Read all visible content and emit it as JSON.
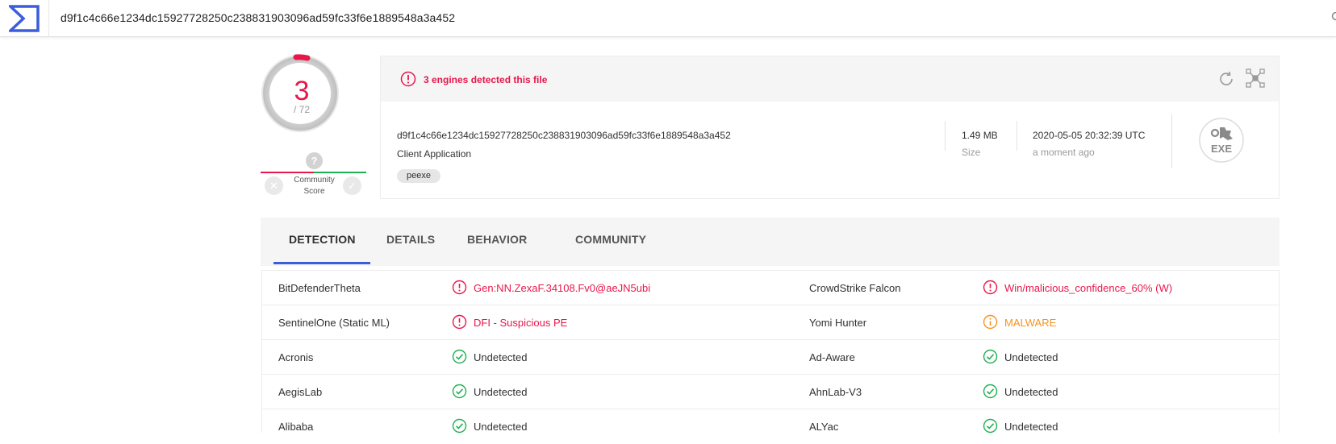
{
  "search": {
    "query": "d9f1c4c66e1234dc15927728250c238831903096ad59fc33f6e1889548a3a452"
  },
  "score": {
    "detected": "3",
    "total": "/ 72"
  },
  "community": {
    "label_line1": "Community",
    "label_line2": "Score",
    "unknown_glyph": "?"
  },
  "summary": {
    "alert": "3 engines detected this file",
    "hash": "d9f1c4c66e1234dc15927728250c238831903096ad59fc33f6e1889548a3a452",
    "file_type": "Client Application",
    "tag": "peexe",
    "size_value": "1.49 MB",
    "size_label": "Size",
    "date_value": "2020-05-05 20:32:39 UTC",
    "date_label": "a moment ago",
    "file_icon_label": "EXE"
  },
  "tabs": [
    {
      "label": "DETECTION",
      "active": true
    },
    {
      "label": "DETAILS",
      "active": false
    },
    {
      "label": "BEHAVIOR",
      "active": false
    },
    {
      "label": "COMMUNITY",
      "active": false
    }
  ],
  "detections": [
    {
      "left": {
        "engine": "BitDefenderTheta",
        "result": "Gen:NN.ZexaF.34108.Fv0@aeJN5ubi",
        "status": "malicious"
      },
      "right": {
        "engine": "CrowdStrike Falcon",
        "result": "Win/malicious_confidence_60% (W)",
        "status": "malicious"
      }
    },
    {
      "left": {
        "engine": "SentinelOne (Static ML)",
        "result": "DFI - Suspicious PE",
        "status": "malicious"
      },
      "right": {
        "engine": "Yomi Hunter",
        "result": "MALWARE",
        "status": "suspicious"
      }
    },
    {
      "left": {
        "engine": "Acronis",
        "result": "Undetected",
        "status": "clean"
      },
      "right": {
        "engine": "Ad-Aware",
        "result": "Undetected",
        "status": "clean"
      }
    },
    {
      "left": {
        "engine": "AegisLab",
        "result": "Undetected",
        "status": "clean"
      },
      "right": {
        "engine": "AhnLab-V3",
        "result": "Undetected",
        "status": "clean"
      }
    },
    {
      "left": {
        "engine": "Alibaba",
        "result": "Undetected",
        "status": "clean"
      },
      "right": {
        "engine": "ALYac",
        "result": "Undetected",
        "status": "clean"
      }
    }
  ],
  "colors": {
    "malicious": "#e8174b",
    "suspicious": "#f7931e",
    "clean": "#20b053",
    "accent": "#3b5ddd"
  }
}
